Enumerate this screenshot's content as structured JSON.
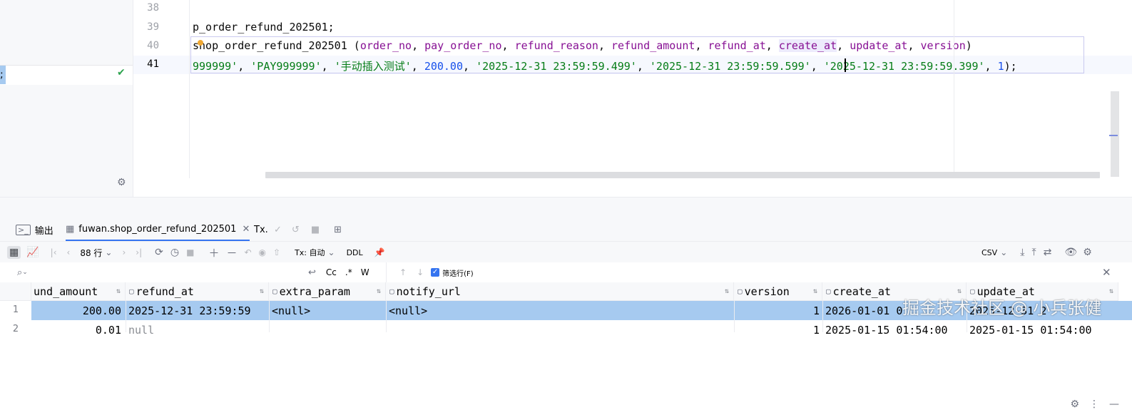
{
  "editor": {
    "line_numbers": [
      "38",
      "39",
      "40",
      "41"
    ],
    "line39": "p_order_refund_202501;",
    "line40": {
      "table": "shop_order_refund_202501 (",
      "cols": [
        "order_no",
        "pay_order_no",
        "refund_reason",
        "refund_amount",
        "refund_at",
        "create_at",
        "update_at",
        "version"
      ],
      "close": ")"
    },
    "line41": {
      "v1": "999999'",
      "v2": "'PAY999999'",
      "v3": "'手动插入测试'",
      "v4": "200.00",
      "v5": "'2025-12-31 23:59:59.499'",
      "v6": "'2025-12-31 23:59:59.599'",
      "v7": "'2025-12-31 23:59:59.399'",
      "v8": "1",
      "tail": ");"
    },
    "left_panel_text": ";"
  },
  "tabs": {
    "output": "输出",
    "data_tab": "fuwan.shop_order_refund_202501",
    "tx": "Tx."
  },
  "toolbar": {
    "rows": "88 行",
    "tx_mode": "Tx: 自动",
    "ddl": "DDL",
    "export": "CSV"
  },
  "filter": {
    "cc": "Cc",
    "regex": ".*",
    "word": "W",
    "filter_rows": "筛选行(F)"
  },
  "grid": {
    "columns": [
      "und_amount",
      "refund_at",
      "extra_param",
      "notify_url",
      "version",
      "create_at",
      "update_at"
    ],
    "rows": [
      {
        "num": "1",
        "und_amount": "200.00",
        "refund_at": "2025-12-31 23:59:59",
        "extra_param": "<null>",
        "notify_url": "<null>",
        "version": "1",
        "create_at": "2026-01-01 0",
        "update_at": "2025-12-31 2"
      },
      {
        "num": "2",
        "und_amount": "0.01",
        "refund_at": "null",
        "extra_param": "",
        "notify_url": "",
        "version": "1",
        "create_at": "2025-01-15 01:54:00",
        "update_at": "2025-01-15 01:54:00"
      }
    ]
  },
  "watermark": "掘金技术社区 @ 小兵张健",
  "colors": {
    "accent": "#3574f0",
    "selection": "#a6caf0",
    "keyword": "#871094",
    "string": "#067d17",
    "number": "#1750eb"
  }
}
